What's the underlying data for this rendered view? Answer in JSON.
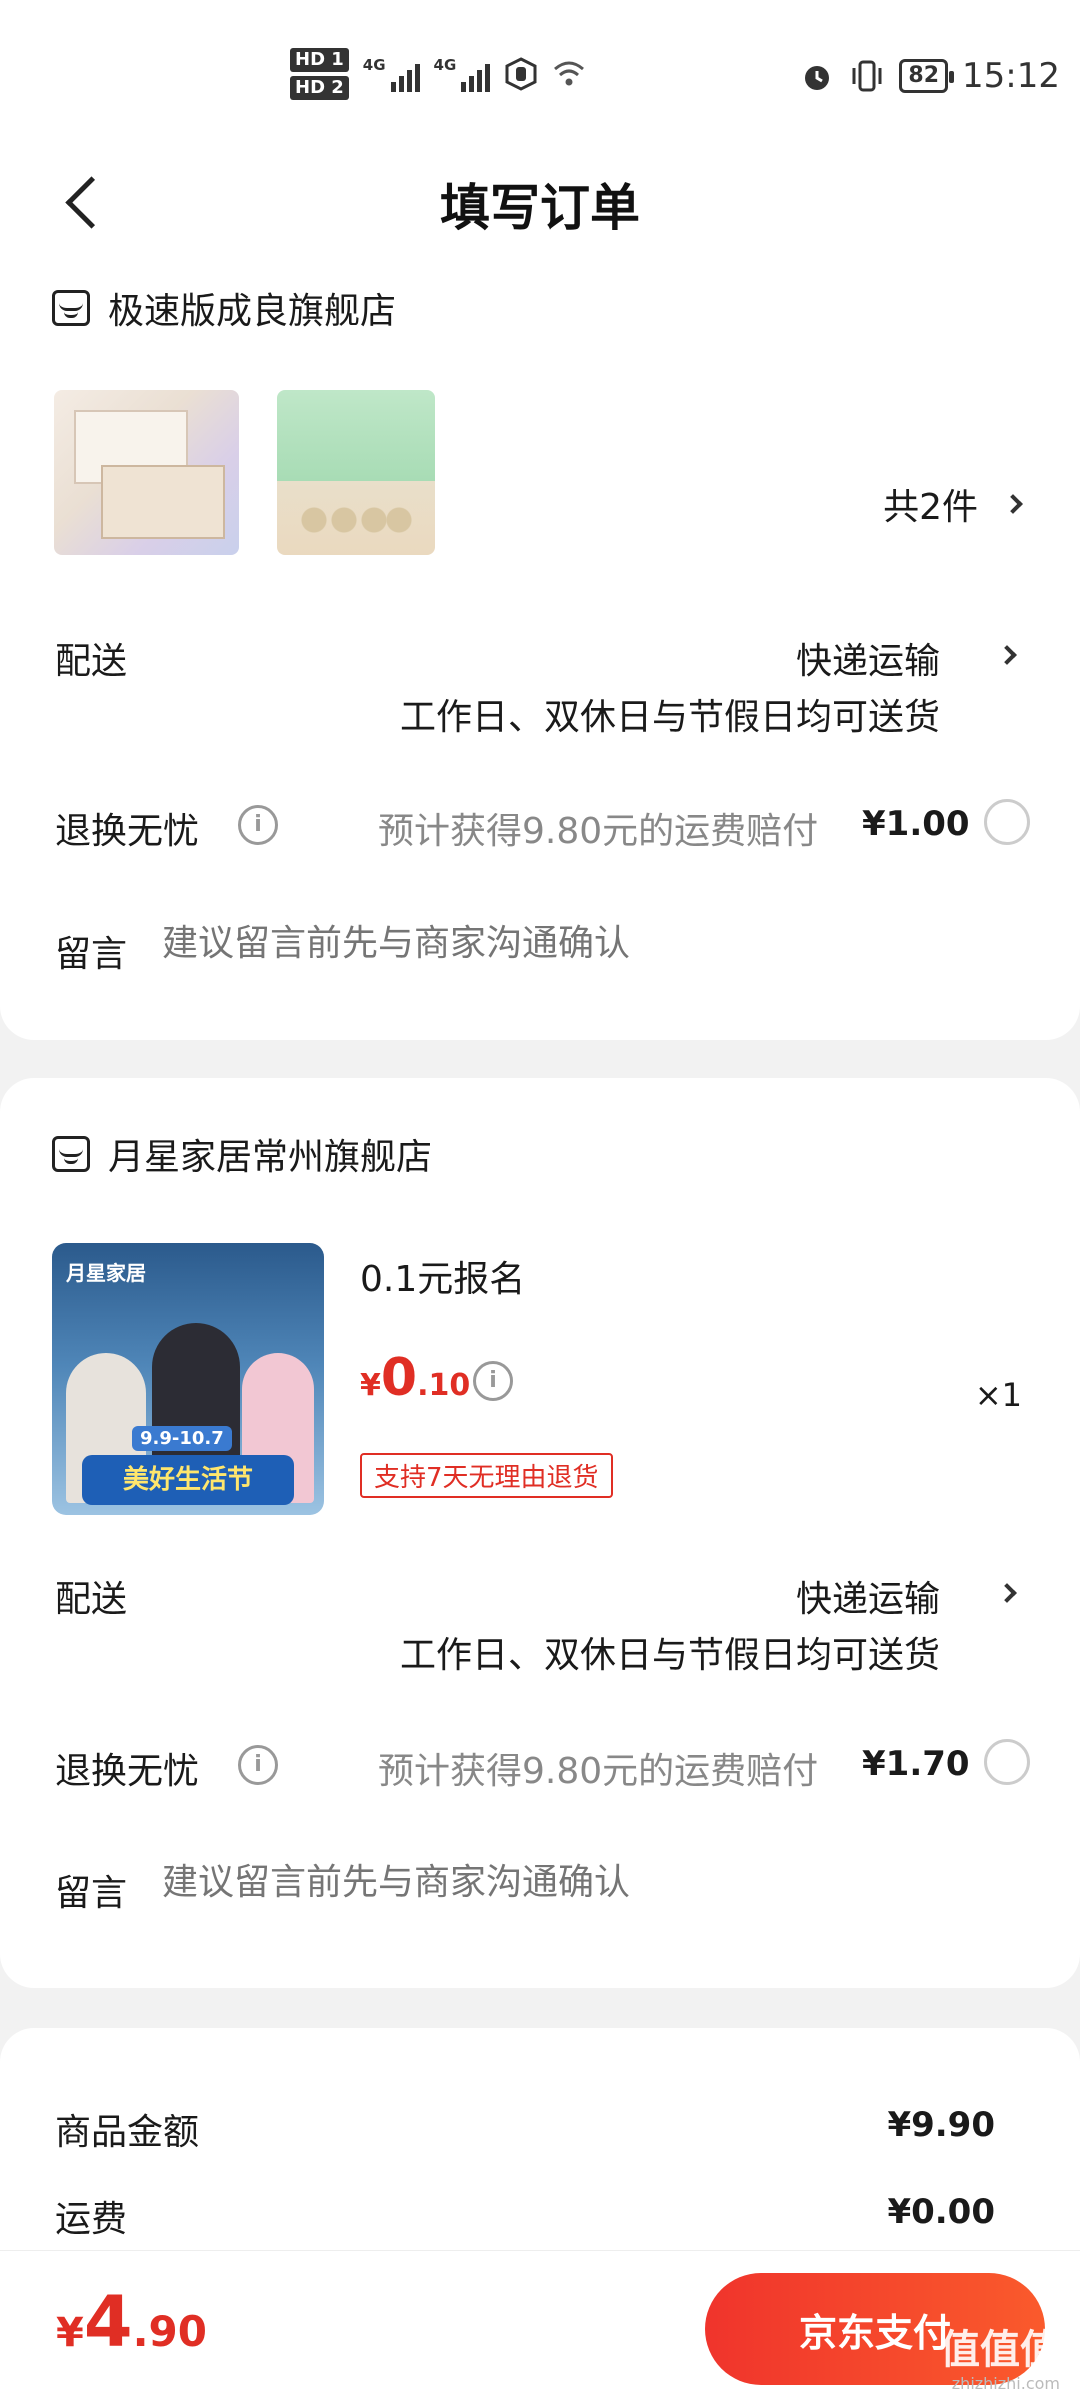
{
  "status_bar": {
    "hd1": "HD 1",
    "hd2": "HD 2",
    "signal1": "4G",
    "signal2": "4G",
    "battery": "82",
    "time": "15:12"
  },
  "header": {
    "title": "填写订单"
  },
  "stores": [
    {
      "name": "极速版成良旗舰店",
      "item_count": "共2件",
      "delivery_label": "配送",
      "delivery_method": "快递运输",
      "delivery_note": "工作日、双休日与节假日均可送货",
      "return_label": "退换无忧",
      "return_desc": "预计获得9.80元的运费赔付",
      "return_price": "¥1.00",
      "message_label": "留言",
      "message_placeholder": "建议留言前先与商家沟通确认"
    },
    {
      "name": "月星家居常州旗舰店",
      "product": {
        "name": "0.1元报名",
        "price_currency": "¥",
        "price_int": "0",
        "price_dec": ".10",
        "quantity": "×1",
        "tag": "支持7天无理由退货",
        "image_text": {
          "logo": "月星家居",
          "date": "9.9-10.7",
          "banner": "美好生活节"
        }
      },
      "delivery_label": "配送",
      "delivery_method": "快递运输",
      "delivery_note": "工作日、双休日与节假日均可送货",
      "return_label": "退换无忧",
      "return_desc": "预计获得9.80元的运费赔付",
      "return_price": "¥1.70",
      "message_label": "留言",
      "message_placeholder": "建议留言前先与商家沟通确认"
    }
  ],
  "summary": {
    "goods_label": "商品金额",
    "goods_value": "¥9.90",
    "shipping_label": "运费",
    "shipping_value": "¥0.00"
  },
  "bottom": {
    "total_currency": "¥",
    "total_int": "4",
    "total_dec": ".90",
    "pay_label": "京东支付",
    "watermark": "值值值",
    "watermark_url": "zhizhizhi.com"
  },
  "colors": {
    "accent_red": "#e02e24",
    "pay_gradient_start": "#f0342c",
    "pay_gradient_end": "#fa5a2c"
  },
  "icons": [
    "back-arrow-icon",
    "store-icon",
    "chevron-right-icon",
    "info-icon",
    "radio-icon",
    "alarm-icon",
    "vibrate-icon",
    "wifi-icon",
    "hand-icon"
  ]
}
